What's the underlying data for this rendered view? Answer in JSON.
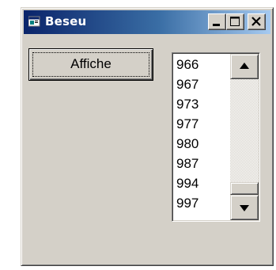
{
  "window": {
    "title": "Beseu",
    "icon": "vb-form-icon",
    "caption_buttons": [
      "minimize",
      "maximize",
      "close"
    ],
    "titlebar_colors": [
      "#0a246a",
      "#a6caf0"
    ],
    "face_color": "#d4d0c8"
  },
  "button": {
    "label": "Affiche"
  },
  "listbox": {
    "items": [
      "966",
      "967",
      "973",
      "977",
      "980",
      "987",
      "994",
      "997"
    ],
    "scroll_position": 1.0
  }
}
